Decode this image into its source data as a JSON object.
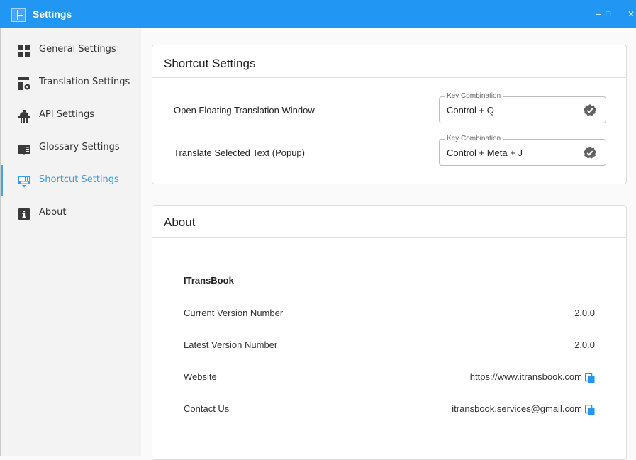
{
  "window": {
    "title": "Settings",
    "minimize_glyph": "−",
    "maximize_glyph": "□",
    "close_glyph": "✕"
  },
  "colors": {
    "titlebar": "#2196f3",
    "active_nav": "#3b9bdc",
    "check_icon": "#616161",
    "copy_icon": "#2196f3"
  },
  "sidebar": {
    "active_index": 4,
    "items": [
      {
        "label": "General Settings",
        "icon": "grid-icon"
      },
      {
        "label": "Translation Settings",
        "icon": "translation-settings-icon"
      },
      {
        "label": "API Settings",
        "icon": "api-icon"
      },
      {
        "label": "Glossary Settings",
        "icon": "book-icon"
      },
      {
        "label": "Shortcut Settings",
        "icon": "keyboard-icon"
      },
      {
        "label": "About",
        "icon": "info-icon"
      }
    ]
  },
  "shortcut_card": {
    "title": "Shortcut Settings",
    "rows": [
      {
        "label": "Open Floating Translation Window",
        "field_label": "Key Combination",
        "value": "Control + Q",
        "icon": "check-badge-icon"
      },
      {
        "label": "Translate Selected Text (Popup)",
        "field_label": "Key Combination",
        "value": "Control + Meta + J",
        "icon": "check-badge-icon"
      }
    ]
  },
  "about_card": {
    "title": "About",
    "app_name": "ITransBook",
    "rows": [
      {
        "key": "Current Version Number",
        "value": "2.0.0"
      },
      {
        "key": "Latest Version Number",
        "value": "2.0.0"
      },
      {
        "key": "Website",
        "value": "https://www.itransbook.com",
        "icon": "copy-icon"
      },
      {
        "key": "Contact Us",
        "value": "itransbook.services@gmail.com",
        "icon": "copy-icon"
      }
    ]
  }
}
